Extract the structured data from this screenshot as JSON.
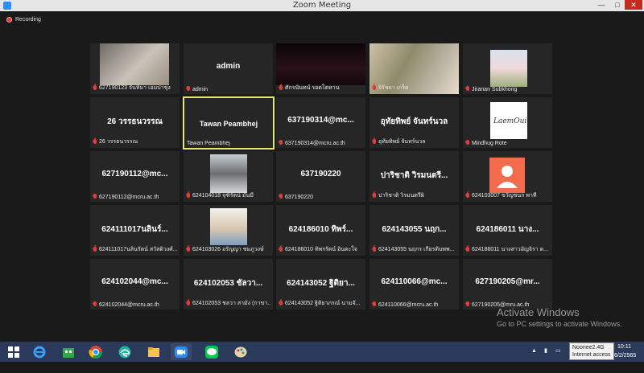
{
  "window": {
    "title": "Zoom Meeting"
  },
  "status": {
    "recording_label": "Recording"
  },
  "participants": [
    {
      "display": "",
      "label": "627190123 จันทิมา เอมปาชุง"
    },
    {
      "display": "admin",
      "label": "admin"
    },
    {
      "display": "",
      "label": "ศักรนันทน์ รอดโตหาน"
    },
    {
      "display": "",
      "label": "จิรัชยา เกร็ด"
    },
    {
      "display": "",
      "label": "Jiranan Subkhong"
    },
    {
      "display": "26 วรรธนวรรณ",
      "label": "26 วรรธนวรรณ"
    },
    {
      "display": "Tawan Peambhej",
      "label": "Tawan Peambhej"
    },
    {
      "display": "637190314@mc...",
      "label": "637190314@mcru.ac.th"
    },
    {
      "display": "อุทัยทิพย์ จันทร์นวล",
      "label": "อุทัยทิพย์ จันทร์นวล"
    },
    {
      "display": "",
      "label": "Mindhug Rote"
    },
    {
      "display": "627190112@mc...",
      "label": "627190112@mcru.ac.th"
    },
    {
      "display": "",
      "label": "624104018 จุฑิรัตน์ มั่นมี"
    },
    {
      "display": "637190220",
      "label": "637190220"
    },
    {
      "display": "ปาริชาติ วิรมนตรี...",
      "label": "ปาริชาติ วิรมนตรีผิ"
    },
    {
      "display": "",
      "label": "624103007 ขวัญชนก พาที"
    },
    {
      "display": "624111017นลินร์...",
      "label": "624111017นลินรัตน์ สวัสดิวงศ์..."
    },
    {
      "display": "",
      "label": "624103026 อรัญญา ชมภูวงษ์"
    },
    {
      "display": "624186010 ทิพร์...",
      "label": "624186010 ทิพรรัตน์ อินตะใจ"
    },
    {
      "display": "624143055 นฤก...",
      "label": "624143055 นฤกร เกียรติบพพ..."
    },
    {
      "display": "624186011 นาง...",
      "label": "624186011 นางสาวอัญจิรา ต..."
    },
    {
      "display": "624102044@mc...",
      "label": "624102044@mcru.ac.th"
    },
    {
      "display": "624102053 ชัลวา...",
      "label": "624102053 ชลวา สามัง (กาขา..."
    },
    {
      "display": "624143052 ฐิติยา...",
      "label": "624143052 ฐิติยาภรณ์ นามจั..."
    },
    {
      "display": "624110066@mc...",
      "label": "624110066@mcru.ac.th"
    },
    {
      "display": "627190205@mr...",
      "label": "627190205@mru.ac.th"
    }
  ],
  "watermark": {
    "line1": "Activate Windows",
    "line2": "Go to PC settings to activate Windows."
  },
  "tray": {
    "tooltip_line1": "Noonee2.4G",
    "tooltip_line2": "Internet access",
    "time": "10:11",
    "date": "6/2/2565"
  },
  "taskbar_apps": [
    "start",
    "internet-explorer",
    "store",
    "chrome",
    "edge",
    "file-explorer",
    "zoom",
    "line",
    "paint"
  ],
  "colors": {
    "tile_bg": "#262626",
    "active_border": "#e3e96b",
    "taskbar": "#2b3a5a",
    "muted_mic": "#e23b3b"
  }
}
